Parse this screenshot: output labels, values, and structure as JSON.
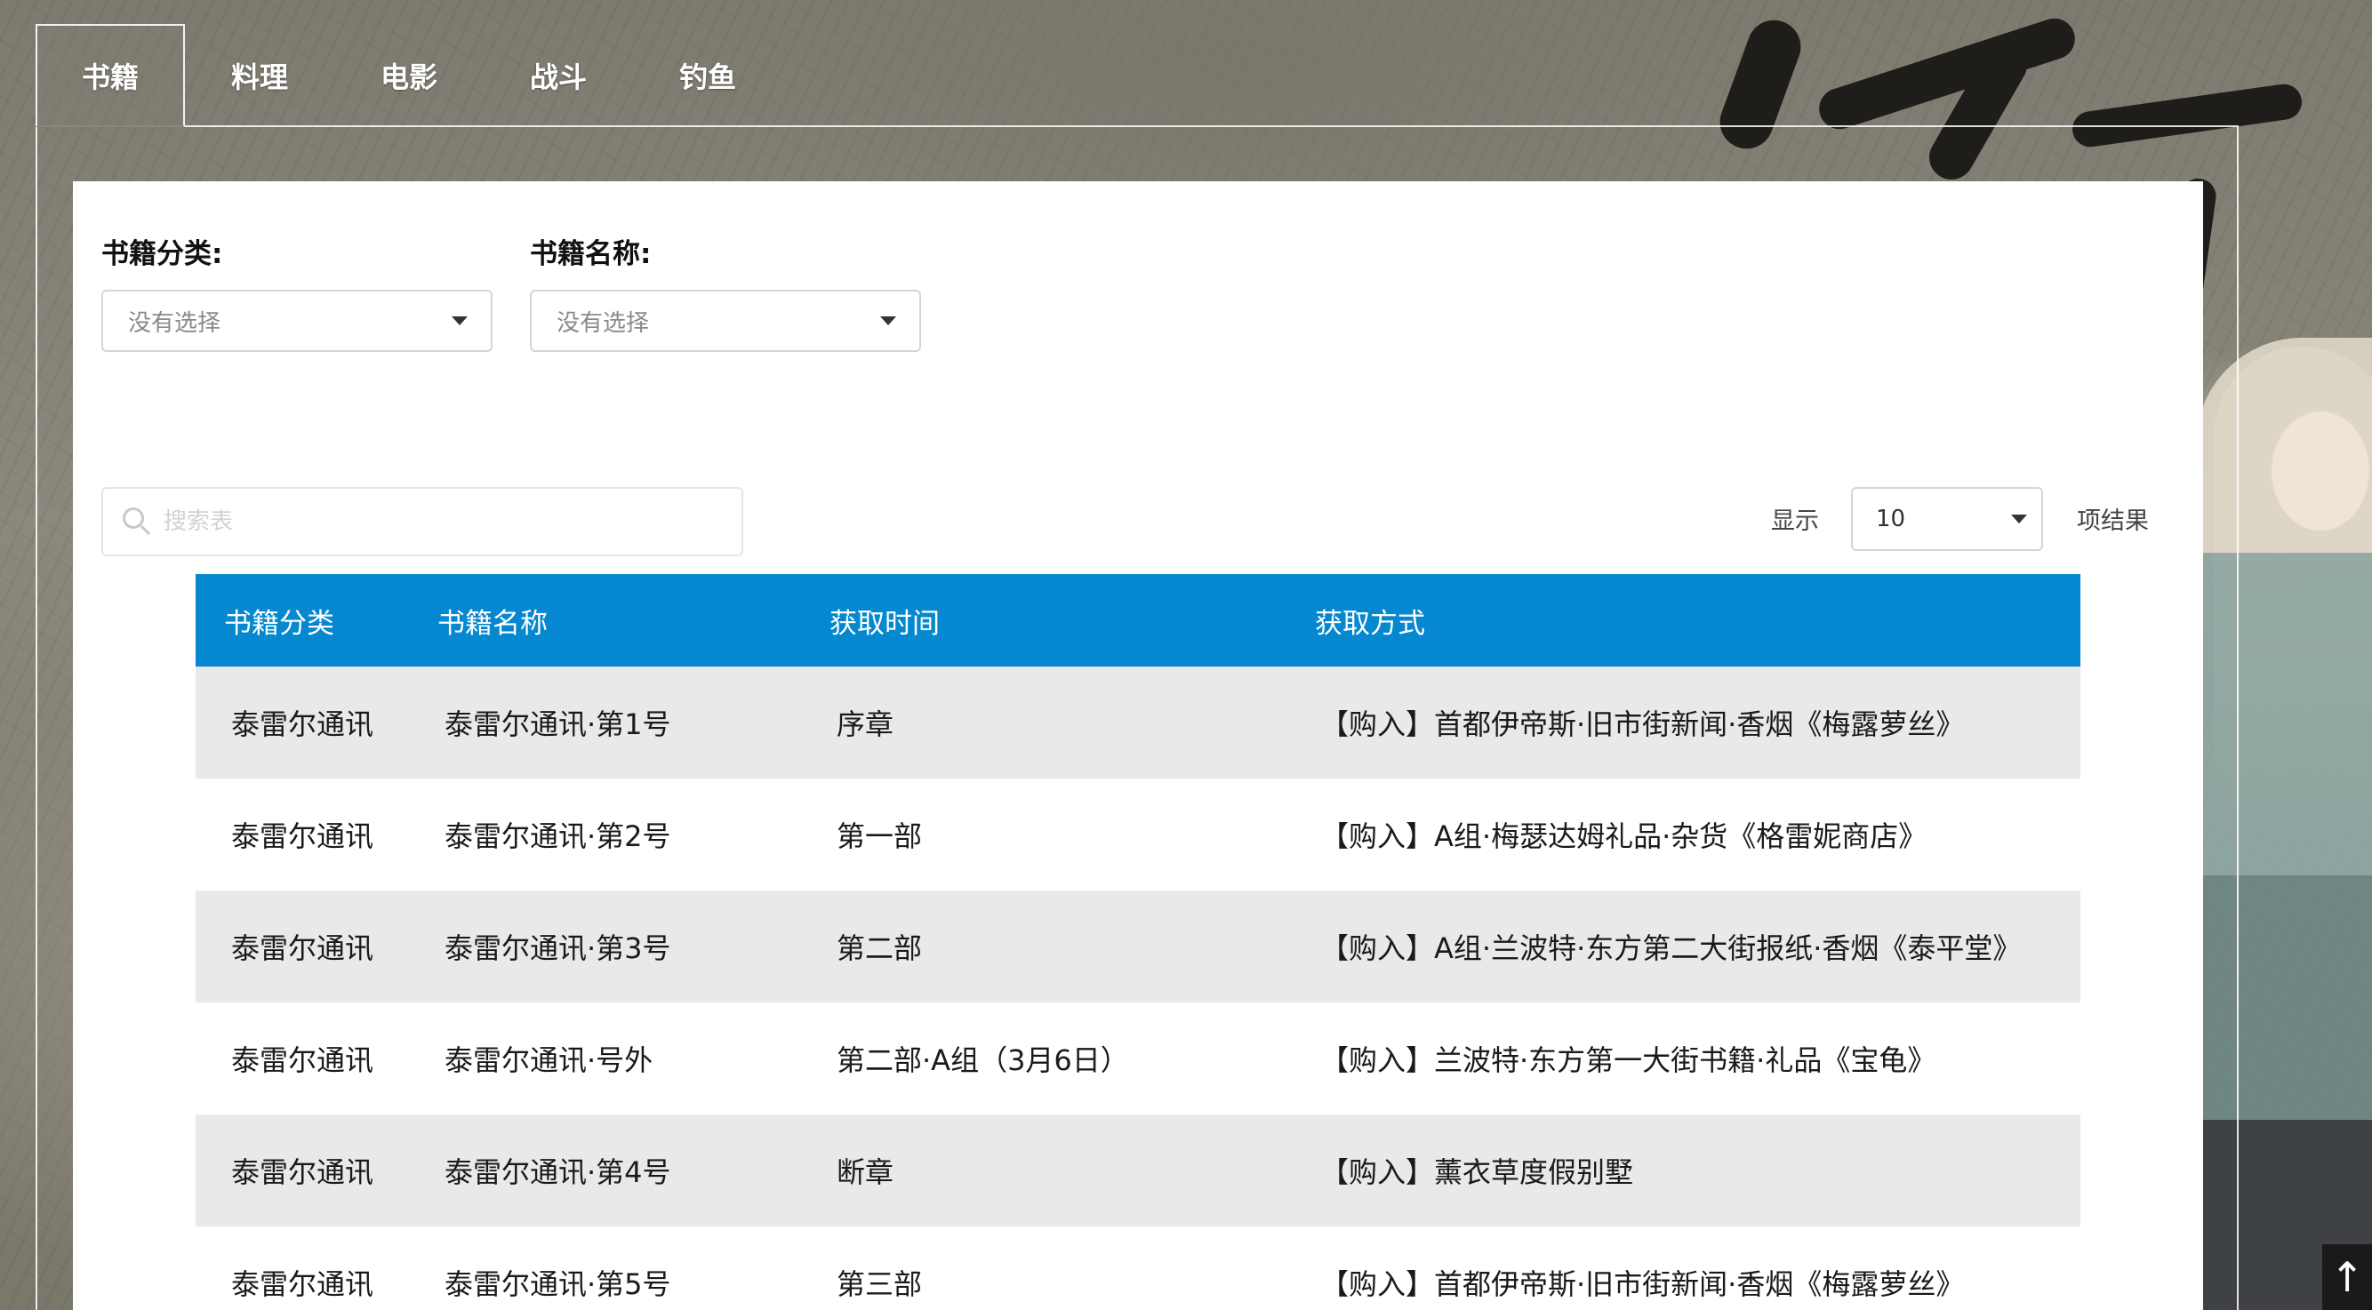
{
  "tabs": [
    {
      "label": "书籍",
      "active": true
    },
    {
      "label": "料理",
      "active": false
    },
    {
      "label": "电影",
      "active": false
    },
    {
      "label": "战斗",
      "active": false
    },
    {
      "label": "钓鱼",
      "active": false
    }
  ],
  "filters": {
    "category": {
      "label": "书籍分类:",
      "value": "没有选择"
    },
    "name": {
      "label": "书籍名称:",
      "value": "没有选择"
    }
  },
  "search": {
    "placeholder": "搜索表",
    "value": ""
  },
  "pagination": {
    "show_label": "显示",
    "page_size": "10",
    "results_label": "项结果"
  },
  "table": {
    "headers": [
      "书籍分类",
      "书籍名称",
      "获取时间",
      "获取方式"
    ],
    "rows": [
      [
        "泰雷尔通讯",
        "泰雷尔通讯·第1号",
        "序章",
        "【购入】首都伊帝斯·旧市街新闻·香烟《梅露萝丝》"
      ],
      [
        "泰雷尔通讯",
        "泰雷尔通讯·第2号",
        "第一部",
        "【购入】A组·梅瑟达姆礼品·杂货《格雷妮商店》"
      ],
      [
        "泰雷尔通讯",
        "泰雷尔通讯·第3号",
        "第二部",
        "【购入】A组·兰波特·东方第二大街报纸·香烟《泰平堂》"
      ],
      [
        "泰雷尔通讯",
        "泰雷尔通讯·号外",
        "第二部·A组（3月6日）",
        "【购入】兰波特·东方第一大街书籍·礼品《宝龟》"
      ],
      [
        "泰雷尔通讯",
        "泰雷尔通讯·第4号",
        "断章",
        "【购入】薰衣草度假别墅"
      ],
      [
        "泰雷尔通讯",
        "泰雷尔通讯·第5号",
        "第三部",
        "【购入】首都伊帝斯·旧市街新闻·香烟《梅露萝丝》"
      ]
    ]
  },
  "back_to_top": {
    "glyph": "↑",
    "icon": "arrow-up-icon"
  },
  "colors": {
    "header_blue": "#0588cf",
    "row_alt": "#e9e8ea"
  }
}
